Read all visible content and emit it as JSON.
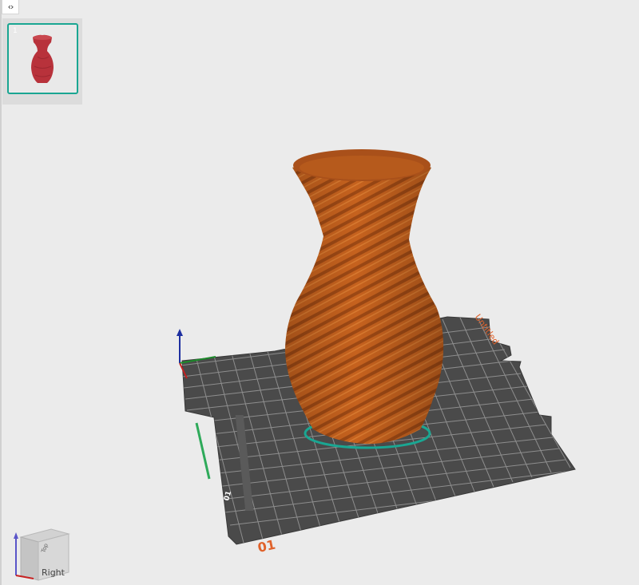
{
  "sidebar": {
    "toggle_icon": "collapse-expand-icon",
    "toggle_glyph": "‹›"
  },
  "plates": [
    {
      "index": "1",
      "selected": true
    }
  ],
  "bed": {
    "label": "Untitled",
    "front_number": "01",
    "side_number": "01",
    "colors": {
      "bed": "#4a4a4a",
      "grid": "#9a9a9a",
      "label": "#e0622b",
      "model": "#c6621e",
      "selection": "#1aa692"
    }
  },
  "view_cube": {
    "face_label": "Right",
    "top_label": "Top"
  }
}
